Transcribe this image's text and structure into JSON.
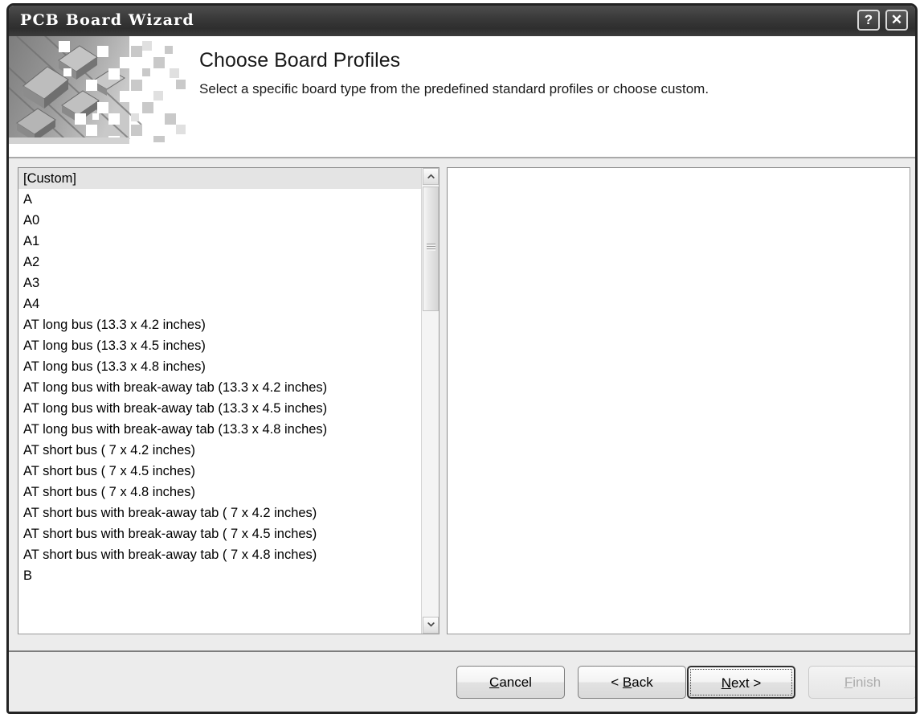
{
  "window": {
    "title": "PCB Board Wizard",
    "help_button": "?",
    "close_button": "✕"
  },
  "header": {
    "title": "Choose Board Profiles",
    "subtitle": "Select a specific board type from the predefined standard profiles or choose custom.",
    "art_icon": "pcb-board-image"
  },
  "list": {
    "selected_index": 0,
    "items": [
      "[Custom]",
      "A",
      "A0",
      "A1",
      "A2",
      "A3",
      "A4",
      "AT long bus (13.3 x 4.2 inches)",
      "AT long bus (13.3 x 4.5 inches)",
      "AT long bus (13.3 x 4.8 inches)",
      "AT long bus with break-away tab (13.3 x 4.2 inches)",
      "AT long bus with break-away tab (13.3 x 4.5 inches)",
      "AT long bus with break-away tab (13.3 x 4.8 inches)",
      "AT short bus ( 7 x 4.2 inches)",
      "AT short bus ( 7 x 4.5 inches)",
      "AT short bus ( 7 x 4.8 inches)",
      "AT short bus with break-away tab ( 7 x 4.2 inches)",
      "AT short bus with break-away tab ( 7 x 4.5 inches)",
      "AT short bus with break-away tab ( 7 x 4.8 inches)",
      "B",
      ""
    ]
  },
  "scrollbar": {
    "up_icon": "chevron-up-icon",
    "down_icon": "chevron-down-icon",
    "thumb_icon": "scrollbar-grip"
  },
  "preview": {
    "content": ""
  },
  "footer": {
    "cancel": {
      "pre": "",
      "accel": "C",
      "post": "ancel"
    },
    "back": {
      "pre": "< ",
      "accel": "B",
      "post": "ack"
    },
    "next": {
      "pre": "",
      "accel": "N",
      "post": "ext >"
    },
    "finish": {
      "pre": "",
      "accel": "F",
      "post": "inish",
      "enabled": false
    }
  },
  "colors": {
    "titlebar": "#3a3a3a",
    "dialog_face": "#ececec",
    "selection": "#e4e4e4",
    "frame": "#232323"
  }
}
